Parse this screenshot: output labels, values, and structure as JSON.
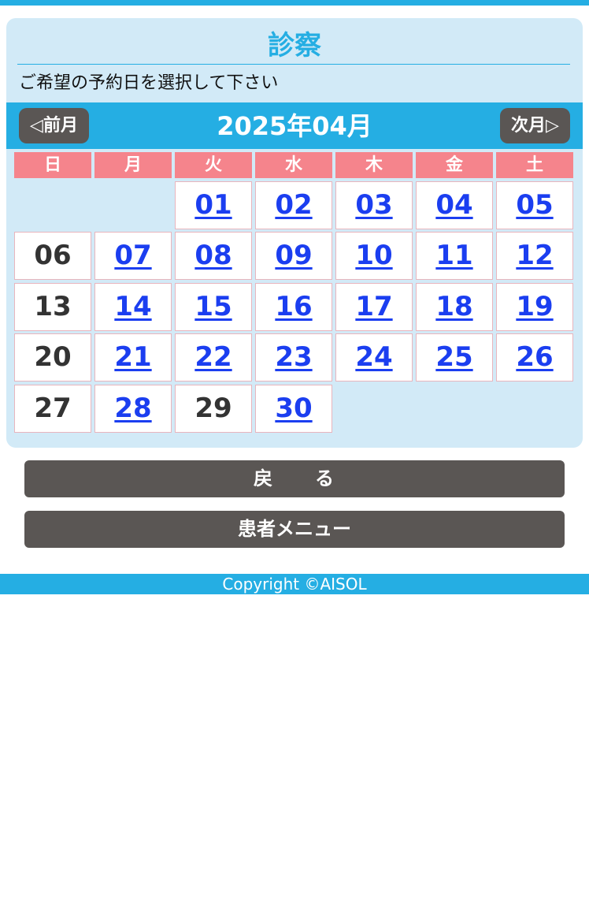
{
  "page": {
    "title": "診察",
    "instruction": "ご希望の予約日を選択して下さい"
  },
  "calendar": {
    "prev_label": "◁前月",
    "next_label": "次月▷",
    "month_label": "2025年04月",
    "weekdays": [
      "日",
      "月",
      "火",
      "水",
      "木",
      "金",
      "土"
    ],
    "weeks": [
      [
        null,
        null,
        {
          "day": "01",
          "available": true
        },
        {
          "day": "02",
          "available": true
        },
        {
          "day": "03",
          "available": true
        },
        {
          "day": "04",
          "available": true
        },
        {
          "day": "05",
          "available": true
        }
      ],
      [
        {
          "day": "06",
          "available": false
        },
        {
          "day": "07",
          "available": true
        },
        {
          "day": "08",
          "available": true
        },
        {
          "day": "09",
          "available": true
        },
        {
          "day": "10",
          "available": true
        },
        {
          "day": "11",
          "available": true
        },
        {
          "day": "12",
          "available": true
        }
      ],
      [
        {
          "day": "13",
          "available": false
        },
        {
          "day": "14",
          "available": true
        },
        {
          "day": "15",
          "available": true
        },
        {
          "day": "16",
          "available": true
        },
        {
          "day": "17",
          "available": true
        },
        {
          "day": "18",
          "available": true
        },
        {
          "day": "19",
          "available": true
        }
      ],
      [
        {
          "day": "20",
          "available": false
        },
        {
          "day": "21",
          "available": true
        },
        {
          "day": "22",
          "available": true
        },
        {
          "day": "23",
          "available": true
        },
        {
          "day": "24",
          "available": true
        },
        {
          "day": "25",
          "available": true
        },
        {
          "day": "26",
          "available": true
        }
      ],
      [
        {
          "day": "27",
          "available": false
        },
        {
          "day": "28",
          "available": true
        },
        {
          "day": "29",
          "available": false
        },
        {
          "day": "30",
          "available": true
        },
        null,
        null,
        null
      ]
    ]
  },
  "actions": {
    "back_label": "戻　　る",
    "menu_label": "患者メニュー"
  },
  "footer": {
    "copyright": "Copyright ©AISOL"
  },
  "colors": {
    "accent": "#25aee3",
    "panel_bg": "#d2eaf7",
    "weekday_header": "#f5848c",
    "button": "#5a5654",
    "link": "#1b3ef0"
  }
}
